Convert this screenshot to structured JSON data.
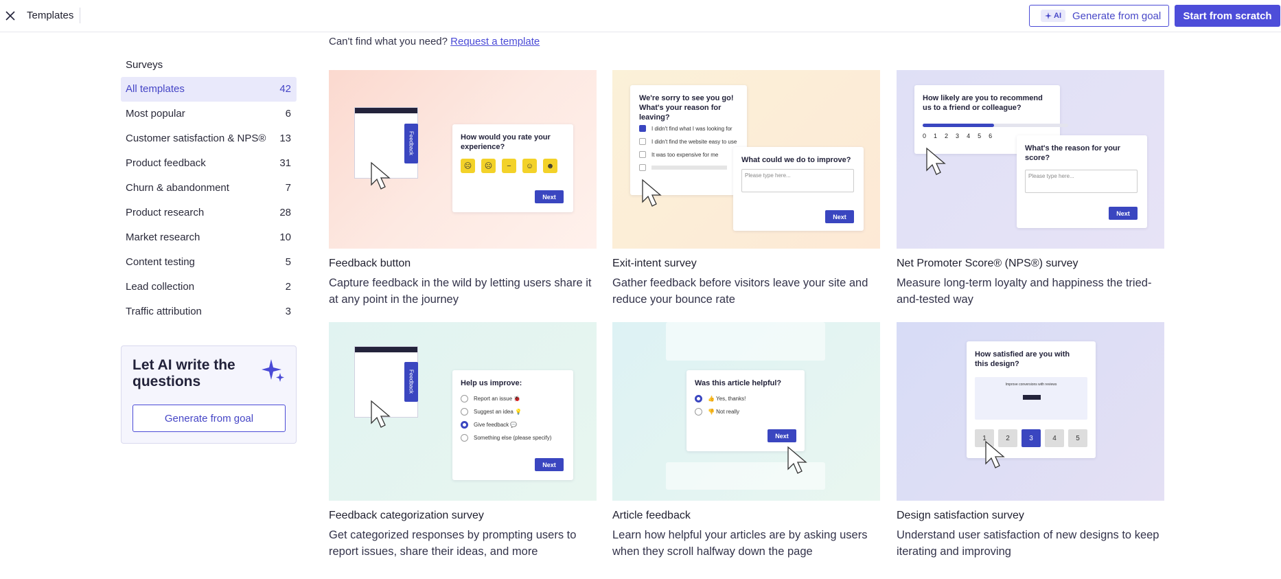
{
  "header": {
    "title": "Templates",
    "ai_badge": "AI",
    "generate_label": "Generate from goal",
    "scratch_label": "Start from scratch"
  },
  "sidebar": {
    "heading": "Surveys",
    "items": [
      {
        "label": "All templates",
        "count": "42"
      },
      {
        "label": "Most popular",
        "count": "6"
      },
      {
        "label": "Customer satisfaction & NPS®",
        "count": "13"
      },
      {
        "label": "Product feedback",
        "count": "31"
      },
      {
        "label": "Churn & abandonment",
        "count": "7"
      },
      {
        "label": "Product research",
        "count": "28"
      },
      {
        "label": "Market research",
        "count": "10"
      },
      {
        "label": "Content testing",
        "count": "5"
      },
      {
        "label": "Lead collection",
        "count": "2"
      },
      {
        "label": "Traffic attribution",
        "count": "3"
      }
    ],
    "ai_box": {
      "title": "Let AI write the questions",
      "button": "Generate from goal"
    }
  },
  "main": {
    "cant_find": "Can't find what you need?",
    "request_link": "Request a template",
    "cards": [
      {
        "title": "Feedback button",
        "desc": "Capture feedback in the wild by letting users share it at any point in the journey"
      },
      {
        "title": "Exit-intent survey",
        "desc": "Gather feedback before visitors leave your site and reduce your bounce rate"
      },
      {
        "title": "Net Promoter Score® (NPS®) survey",
        "desc": "Measure long-term loyalty and happiness the tried-and-tested way"
      },
      {
        "title": "Feedback categorization survey",
        "desc": "Get categorized responses by prompting users to report issues, share their ideas, and more"
      },
      {
        "title": "Article feedback",
        "desc": "Learn how helpful your articles are by asking users when they scroll halfway down the page"
      },
      {
        "title": "Design satisfaction survey",
        "desc": "Understand user satisfaction of new designs to keep iterating and improving"
      }
    ]
  },
  "previews": {
    "next": "Next",
    "feedback_tab": "Feedback",
    "placeholder": "Please type here...",
    "fb_button_q": "How would you rate your experience?",
    "exit_q": "We're sorry to see you go! What's your reason for leaving?",
    "exit_opts": [
      "I didn't find what I was looking for",
      "I didn't find the website easy to use",
      "It was too expensive for me"
    ],
    "exit_q2": "What could we do to improve?",
    "nps_q": "How likely are you to recommend us to a friend or colleague?",
    "nps_nums": [
      "0",
      "1",
      "2",
      "3",
      "4",
      "5",
      "6"
    ],
    "nps_q2": "What's the reason for your score?",
    "cat_q": "Help us improve:",
    "cat_opts": [
      "Report an issue 🐞",
      "Suggest an idea 💡",
      "Give feedback 💬",
      "Something else (please specify)"
    ],
    "article_q": "Was this article helpful?",
    "article_opts": [
      "👍 Yes, thanks!",
      "👎 Not really"
    ],
    "design_q": "How satisfied are you with this design?",
    "design_banner": "Improve conversions with reviews",
    "design_scale": [
      "1",
      "2",
      "3",
      "4",
      "5"
    ]
  }
}
